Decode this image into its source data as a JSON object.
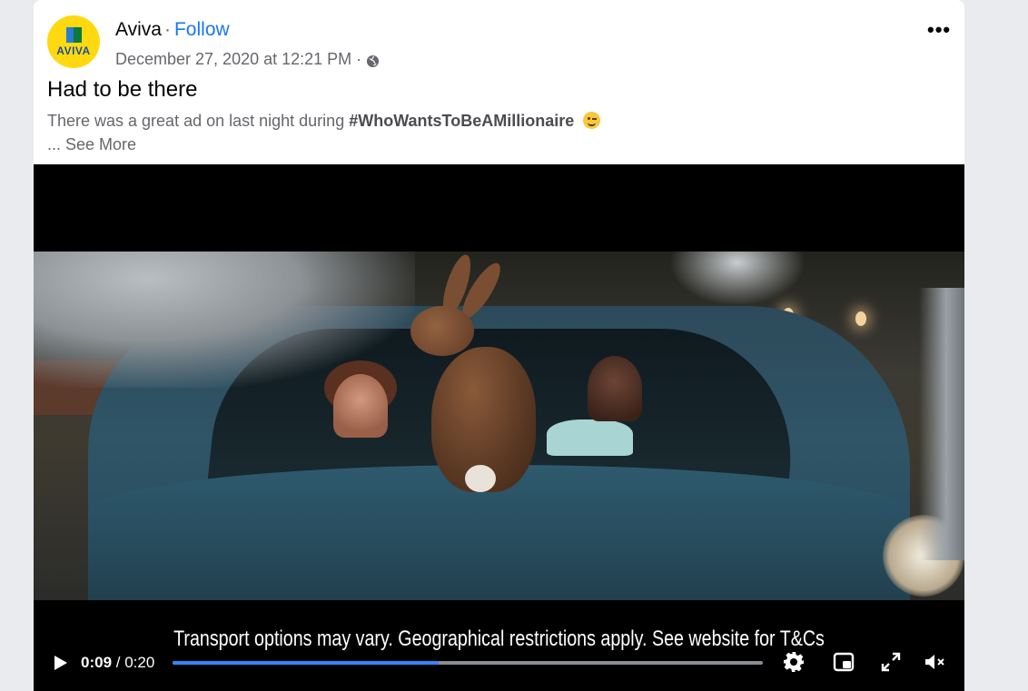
{
  "post": {
    "author": "Aviva",
    "separator": "·",
    "follow_label": "Follow",
    "timestamp": "December 27, 2020 at 12:21 PM",
    "timestamp_separator": "·",
    "audience_icon": "globe-icon",
    "more_icon": "more-options-icon",
    "more_label": "•••",
    "title": "Had to be there",
    "body_prefix": "There was a great ad on last night during",
    "hashtag": "#WhoWantsToBeAMillionaire",
    "emoji": "winking-face-emoji",
    "see_more": "... See More",
    "avatar": {
      "wordmark": "AVIVA",
      "background": "#ffd90f"
    }
  },
  "video": {
    "caption": "Transport options may vary. Geographical restrictions apply. See website for T&Cs",
    "current_time": "0:09",
    "time_separator": " / ",
    "duration": "0:20",
    "progress": 0.45,
    "controls": {
      "play_icon": "play-icon",
      "settings_icon": "gear-icon",
      "pip_icon": "picture-in-picture-icon",
      "fullscreen_icon": "fullscreen-icon",
      "mute_icon": "muted-speaker-icon"
    },
    "accent_color": "#2d88ff"
  },
  "colors": {
    "link": "#1877f2",
    "secondary_text": "#65676b",
    "page_background": "#e9ebee"
  }
}
